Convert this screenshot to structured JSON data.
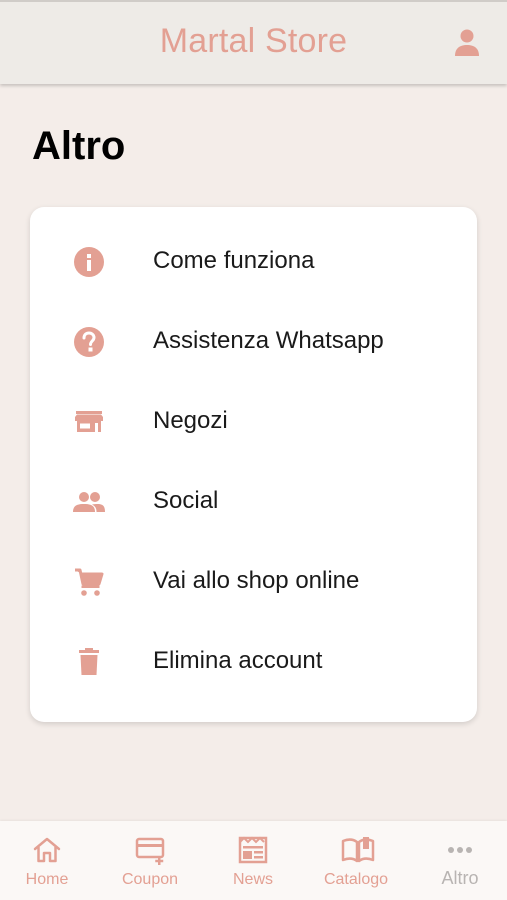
{
  "header": {
    "title": "Martal Store",
    "user_icon": "user-icon"
  },
  "page": {
    "title": "Altro"
  },
  "menu": {
    "items": [
      {
        "label": "Come funziona",
        "icon": "info-icon"
      },
      {
        "label": "Assistenza Whatsapp",
        "icon": "help-icon"
      },
      {
        "label": "Negozi",
        "icon": "store-icon"
      },
      {
        "label": "Social",
        "icon": "people-icon"
      },
      {
        "label": "Vai allo shop online",
        "icon": "cart-icon"
      },
      {
        "label": "Elimina account",
        "icon": "trash-icon"
      }
    ]
  },
  "nav": {
    "items": [
      {
        "label": "Home",
        "icon": "home-icon",
        "active": true
      },
      {
        "label": "Coupon",
        "icon": "coupon-icon",
        "active": true
      },
      {
        "label": "News",
        "icon": "news-icon",
        "active": true
      },
      {
        "label": "Catalogo",
        "icon": "catalog-icon",
        "active": true
      },
      {
        "label": "Altro",
        "icon": "more-icon",
        "active": false
      }
    ]
  },
  "colors": {
    "accent": "#e3a093",
    "inactive": "#b8b4b2",
    "background": "#f4ede9",
    "header_bg": "#eeebe7"
  }
}
